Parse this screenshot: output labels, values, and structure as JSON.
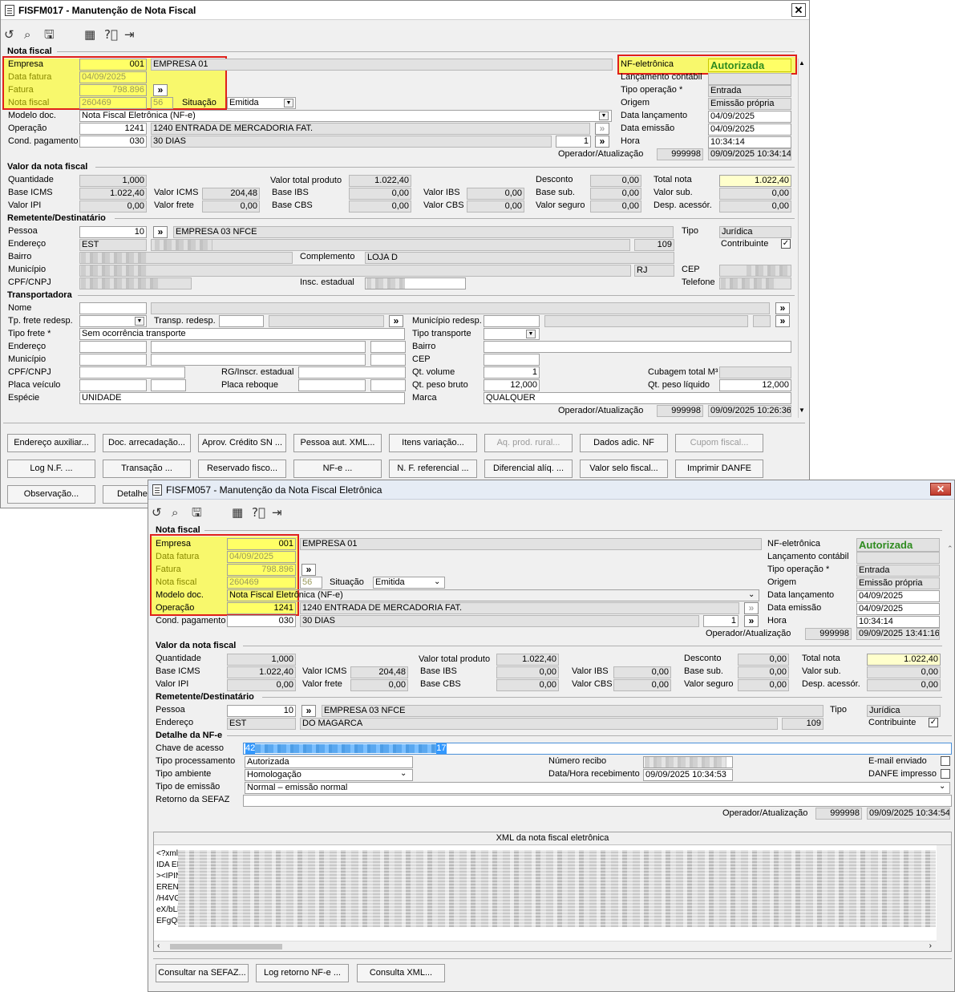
{
  "w1": {
    "title": "FISFM017 - Manutenção de Nota Fiscal",
    "close": "✕",
    "nf": {
      "section": "Nota fiscal",
      "empresa_l": "Empresa",
      "empresa_c": "001",
      "empresa_n": "EMPRESA 01",
      "data_fatura_l": "Data fatura",
      "data_fatura": "04/09/2025",
      "fatura_l": "Fatura",
      "fatura": "798.896",
      "nota_l": "Nota fiscal",
      "nota": "260469",
      "serie": "56",
      "situacao_l": "Situação",
      "situacao": "Emitida",
      "modelo_l": "Modelo doc.",
      "modelo": "Nota Fiscal Eletrônica (NF-e)",
      "operacao_l": "Operação",
      "operacao_c": "1241",
      "operacao_n": "1240 ENTRADA DE MERCADORIA FAT.",
      "cond_l": "Cond. pagamento",
      "cond_c": "030",
      "cond_n": "30 DIAS",
      "cond_q": "1",
      "nfe_l": "NF-eletrônica",
      "nfe": "Autorizada",
      "lanc_contabil_l": "Lançamento contábil",
      "tipo_op_l": "Tipo operação *",
      "tipo_op": "Entrada",
      "origem_l": "Origem",
      "origem": "Emissão própria",
      "data_lanc_l": "Data lançamento",
      "data_lanc": "04/09/2025",
      "data_emis_l": "Data emissão",
      "data_emis": "04/09/2025",
      "hora_l": "Hora",
      "hora": "10:34:14",
      "op_atual_l": "Operador/Atualização",
      "op_user": "999998",
      "op_date": "09/09/2025 10:34:14"
    },
    "valor": {
      "section": "Valor da nota fiscal",
      "qtd_l": "Quantidade",
      "qtd": "1,000",
      "base_icms_l": "Base ICMS",
      "base_icms": "1.022,40",
      "ipi_l": "Valor IPI",
      "ipi": "0,00",
      "vicms_l": "Valor ICMS",
      "vicms": "204,48",
      "vfrete_l": "Valor frete",
      "vfrete": "0,00",
      "vtp_l": "Valor total produto",
      "vtp": "1.022,40",
      "bibs_l": "Base IBS",
      "bibs": "0,00",
      "bcbs_l": "Base CBS",
      "bcbs": "0,00",
      "vibs_l": "Valor IBS",
      "vibs": "0,00",
      "vcbs_l": "Valor CBS",
      "vcbs": "0,00",
      "desc_l": "Desconto",
      "desc": "0,00",
      "bsub_l": "Base sub.",
      "bsub": "0,00",
      "vseg_l": "Valor seguro",
      "vseg": "0,00",
      "total_l": "Total nota",
      "total": "1.022,40",
      "vsub_l": "Valor sub.",
      "vsub": "0,00",
      "desp_l": "Desp. acessór.",
      "desp": "0,00"
    },
    "rem": {
      "section": "Remetente/Destinatário",
      "pessoa_l": "Pessoa",
      "pessoa_c": "10",
      "pessoa_n": "EMPRESA 03 NFCE",
      "end_l": "Endereço",
      "end_tipo": "EST",
      "end_num": "109",
      "bairro_l": "Bairro",
      "compl_l": "Complemento",
      "compl": "LOJA D",
      "mun_l": "Município",
      "uf": "RJ",
      "cpf_l": "CPF/CNPJ",
      "insc_l": "Insc. estadual",
      "tipo_l": "Tipo",
      "tipo": "Jurídica",
      "contrib_l": "Contribuinte",
      "contrib_check": "✓",
      "cep_l": "CEP",
      "tel_l": "Telefone"
    },
    "transp": {
      "section": "Transportadora",
      "nome_l": "Nome",
      "tpfrete_redesp_l": "Tp. frete redesp.",
      "transp_redesp_l": "Transp. redesp.",
      "mun_redesp_l": "Município redesp.",
      "tipo_frete_l": "Tipo frete *",
      "tipo_frete": "Sem ocorrência transporte",
      "tipo_transp_l": "Tipo transporte",
      "end_l": "Endereço",
      "bairro_l": "Bairro",
      "mun_l": "Município",
      "cep_l": "CEP",
      "cpf_l": "CPF/CNPJ",
      "rg_l": "RG/Inscr. estadual",
      "qt_vol_l": "Qt. volume",
      "qt_vol": "1",
      "cub_l": "Cubagem total M³",
      "placa_l": "Placa veículo",
      "reboque_l": "Placa reboque",
      "peso_bruto_l": "Qt. peso bruto",
      "peso_bruto": "12,000",
      "peso_liq_l": "Qt. peso líquido",
      "peso_liq": "12,000",
      "especie_l": "Espécie",
      "especie": "UNIDADE",
      "marca_l": "Marca",
      "marca": "QUALQUER",
      "op_atual_l": "Operador/Atualização",
      "op_user": "999998",
      "op_date": "09/09/2025 10:26:36"
    },
    "buttons": {
      "endereco_aux": "Endereço auxiliar...",
      "doc_arrec": "Doc. arrecadação...",
      "aprov_credito": "Aprov. Crédito SN ...",
      "pessoa_xml": "Pessoa aut. XML...",
      "itens_var": "Itens variação...",
      "aq_prod": "Aq. prod. rural...",
      "dados_nf": "Dados adic. NF",
      "cupom": "Cupom fiscal...",
      "log_nf": "Log N.F. ...",
      "transacao": "Transação ...",
      "reservado": "Reservado fisco...",
      "nfe_btn": "NF-e ...",
      "nf_ref": "N. F. referencial ...",
      "dif_aliq": "Diferencial alíq. ...",
      "valor_selo": "Valor selo fiscal...",
      "imprimir": "Imprimir DANFE",
      "observacao": "Observação...",
      "detalhe": "Detalhe"
    }
  },
  "w2": {
    "title": "FISFM057 - Manutenção da Nota Fiscal Eletrônica",
    "close": "✕",
    "nf": {
      "section": "Nota fiscal",
      "empresa_l": "Empresa",
      "empresa_c": "001",
      "empresa_n": "EMPRESA 01",
      "data_fatura_l": "Data fatura",
      "data_fatura": "04/09/2025",
      "fatura_l": "Fatura",
      "fatura": "798.896",
      "nota_l": "Nota fiscal",
      "nota": "260469",
      "serie": "56",
      "situacao_l": "Situação",
      "situacao": "Emitida",
      "modelo_l": "Modelo doc.",
      "modelo": "Nota Fiscal Eletrônica (NF-e)",
      "operacao_l": "Operação",
      "operacao_c": "1241",
      "operacao_n": "1240 ENTRADA DE MERCADORIA FAT.",
      "cond_l": "Cond. pagamento",
      "cond_c": "030",
      "cond_n": "30 DIAS",
      "cond_q": "1",
      "nfe_l": "NF-eletrônica",
      "nfe": "Autorizada",
      "lanc_contabil_l": "Lançamento contábil",
      "tipo_op_l": "Tipo operação *",
      "tipo_op": "Entrada",
      "origem_l": "Origem",
      "origem": "Emissão própria",
      "data_lanc_l": "Data lançamento",
      "data_lanc": "04/09/2025",
      "data_emis_l": "Data emissão",
      "data_emis": "04/09/2025",
      "hora_l": "Hora",
      "hora": "10:34:14",
      "op_atual_l": "Operador/Atualização",
      "op_user": "999998",
      "op_date": "09/09/2025 13:41:16"
    },
    "valor": {
      "section": "Valor da nota fiscal",
      "qtd_l": "Quantidade",
      "qtd": "1,000",
      "base_icms_l": "Base ICMS",
      "base_icms": "1.022,40",
      "ipi_l": "Valor IPI",
      "ipi": "0,00",
      "vicms_l": "Valor ICMS",
      "vicms": "204,48",
      "vfrete_l": "Valor frete",
      "vfrete": "0,00",
      "vtp_l": "Valor total produto",
      "vtp": "1.022,40",
      "bibs_l": "Base IBS",
      "bibs": "0,00",
      "bcbs_l": "Base CBS",
      "bcbs": "0,00",
      "vibs_l": "Valor IBS",
      "vibs": "0,00",
      "vcbs_l": "Valor CBS",
      "vcbs": "0,00",
      "desc_l": "Desconto",
      "desc": "0,00",
      "bsub_l": "Base sub.",
      "bsub": "0,00",
      "vseg_l": "Valor seguro",
      "vseg": "0,00",
      "total_l": "Total nota",
      "total": "1.022,40",
      "vsub_l": "Valor sub.",
      "vsub": "0,00",
      "desp_l": "Desp. acessór.",
      "desp": "0,00"
    },
    "rem": {
      "section": "Remetente/Destinatário",
      "pessoa_l": "Pessoa",
      "pessoa_c": "10",
      "pessoa_n": "EMPRESA 03 NFCE",
      "end_l": "Endereço",
      "end_tipo": "EST",
      "end_n": "DO MAGARCA",
      "end_num": "109",
      "tipo_l": "Tipo",
      "tipo": "Jurídica",
      "contrib_l": "Contribuinte",
      "contrib_check": "✓"
    },
    "det": {
      "section": "Detalhe da NF-e",
      "chave_l": "Chave de acesso",
      "chave_a": "42",
      "chave_b": "17",
      "tproc_l": "Tipo processamento",
      "tproc": "Autorizada",
      "tamb_l": "Tipo ambiente",
      "tamb": "Homologação",
      "temis_l": "Tipo de emissão",
      "temis": "Normal – emissão normal",
      "retorno_l": "Retorno da SEFAZ",
      "recibo_l": "Número recibo",
      "dhrec_l": "Data/Hora recebimento",
      "dhrec": "09/09/2025 10:34:53",
      "email_l": "E-mail enviado",
      "danfe_l": "DANFE impresso",
      "op_atual_l": "Operador/Atualização",
      "op_user": "999998",
      "op_date": "09/09/2025 10:34:54"
    },
    "xml": {
      "header": "XML da nota fiscal eletrônica",
      "lines": [
        "<?xml",
        "IDA EM",
        "><IPIN",
        "ERENC",
        "/H4VG",
        "eX/bLl",
        "EFgQl"
      ]
    },
    "buttons": {
      "consultar": "Consultar na SEFAZ...",
      "log_ret": "Log retorno NF-e ...",
      "consulta_xml": "Consulta XML..."
    }
  },
  "colors": {
    "highlight": "#ffff00",
    "red_border": "#e0201a",
    "authorized": "#2e8b1f"
  },
  "icons": [
    "undo-icon",
    "search-icon",
    "save-icon",
    "calendar-icon",
    "help-icon",
    "exit-icon"
  ]
}
